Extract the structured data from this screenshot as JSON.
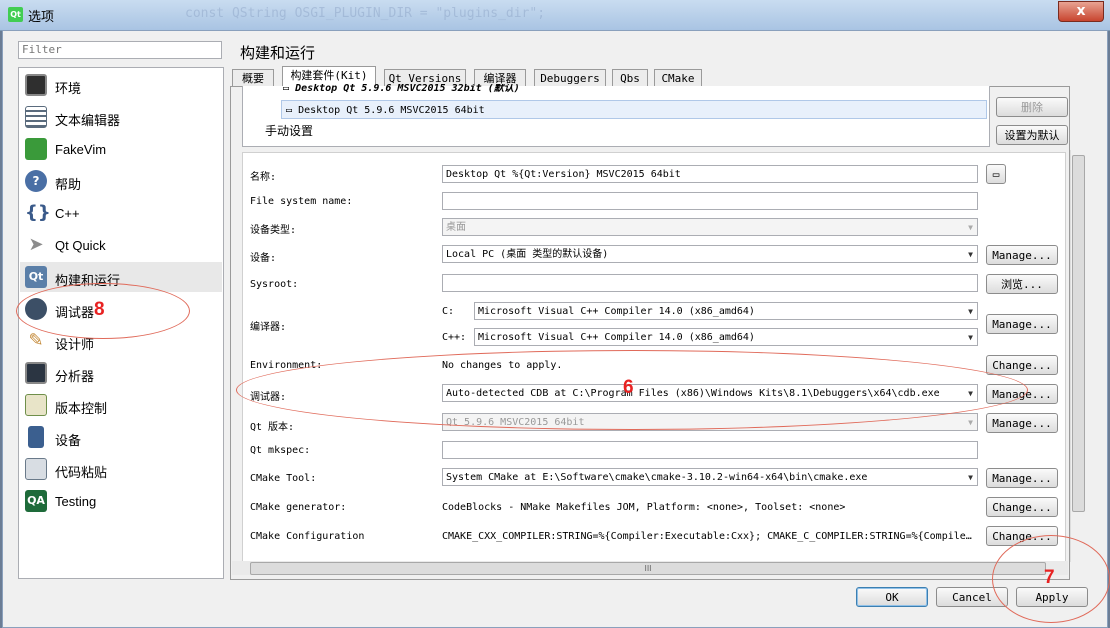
{
  "window": {
    "title": "选项",
    "logo_text": "Qt",
    "close_glyph": "x",
    "background_code": "const QString OSGI_PLUGIN_DIR = \"plugins_dir\";"
  },
  "filter": {
    "placeholder": "Filter"
  },
  "sidebar": {
    "items": [
      {
        "label": "环境",
        "icon": "monitor-icon",
        "color": "#333333"
      },
      {
        "label": "文本编辑器",
        "icon": "text-editor-icon",
        "color": "#5a6b7d"
      },
      {
        "label": "FakeVim",
        "icon": "fakevim-icon",
        "color": "#3a9a3a"
      },
      {
        "label": "帮助",
        "icon": "help-icon",
        "color": "#4a6fa5"
      },
      {
        "label": "C++",
        "icon": "cpp-icon",
        "color": "#3a5a8a"
      },
      {
        "label": "Qt Quick",
        "icon": "qtquick-icon",
        "color": "#8c8c8c"
      },
      {
        "label": "构建和运行",
        "icon": "build-run-icon",
        "color": "#5b7fa8"
      },
      {
        "label": "调试器",
        "icon": "debugger-icon",
        "color": "#3c4f66"
      },
      {
        "label": "设计师",
        "icon": "designer-icon",
        "color": "#c58b3a"
      },
      {
        "label": "分析器",
        "icon": "analyzer-icon",
        "color": "#2b3542"
      },
      {
        "label": "版本控制",
        "icon": "version-control-icon",
        "color": "#6f8f4a"
      },
      {
        "label": "设备",
        "icon": "device-icon",
        "color": "#3b5f8f"
      },
      {
        "label": "代码粘贴",
        "icon": "code-paste-icon",
        "color": "#6a7a8a"
      },
      {
        "label": "Testing",
        "icon": "qa-testing-icon",
        "color": "#1e6b3a"
      }
    ],
    "selected_index": 6
  },
  "page": {
    "title": "构建和运行"
  },
  "tabs": [
    {
      "label": "概要"
    },
    {
      "label": "构建套件(Kit)"
    },
    {
      "label": "Qt Versions"
    },
    {
      "label": "编译器"
    },
    {
      "label": "Debuggers"
    },
    {
      "label": "Qbs"
    },
    {
      "label": "CMake"
    }
  ],
  "kits": {
    "items": [
      "Desktop Qt 5.9.6 MSVC2015 32bit (默认)",
      "Desktop Qt 5.9.6 MSVC2015 64bit"
    ],
    "manual_label": "手动设置",
    "remove_button": "删除",
    "set_default_button": "设置为默认"
  },
  "form": {
    "name_label": "名称:",
    "name_value": "Desktop Qt %{Qt:Version} MSVC2015 64bit",
    "fs_name_label": "File system name:",
    "fs_name_value": "",
    "device_type_label": "设备类型:",
    "device_type_value": "桌面",
    "device_label": "设备:",
    "device_value": "Local PC (桌面 类型的默认设备)",
    "sysroot_label": "Sysroot:",
    "sysroot_value": "",
    "compiler_label": "编译器:",
    "c_label": "C:",
    "c_value": "Microsoft Visual C++ Compiler 14.0 (x86_amd64)",
    "cpp_label": "C++:",
    "cpp_value": "Microsoft Visual C++ Compiler 14.0 (x86_amd64)",
    "env_label": "Environment:",
    "env_value": "No changes to apply.",
    "debugger_label": "调试器:",
    "debugger_value": "Auto-detected CDB at C:\\Program Files (x86)\\Windows Kits\\8.1\\Debuggers\\x64\\cdb.exe",
    "qt_version_label": "Qt 版本:",
    "qt_version_value": "Qt 5.9.6 MSVC2015 64bit",
    "mkspec_label": "Qt mkspec:",
    "mkspec_value": "",
    "cmake_tool_label": "CMake Tool:",
    "cmake_tool_value": "System CMake at E:\\Software\\cmake\\cmake-3.10.2-win64-x64\\bin\\cmake.exe",
    "cmake_gen_label": "CMake generator:",
    "cmake_gen_value": "CodeBlocks - NMake Makefiles JOM, Platform: <none>, Toolset: <none>",
    "cmake_conf_label": "CMake Configuration",
    "cmake_conf_value": "CMAKE_CXX_COMPILER:STRING=%{Compiler:Executable:Cxx}; CMAKE_C_COMPILER:STRING=%{Compile…",
    "manage_label": "Manage...",
    "browse_label": "浏览...",
    "change_label": "Change..."
  },
  "hscroll_grip": "III",
  "footer": {
    "ok": "OK",
    "cancel": "Cancel",
    "apply": "Apply"
  },
  "annotations": {
    "n8": "8",
    "n6": "6",
    "n7": "7",
    "color": "#e82222"
  }
}
